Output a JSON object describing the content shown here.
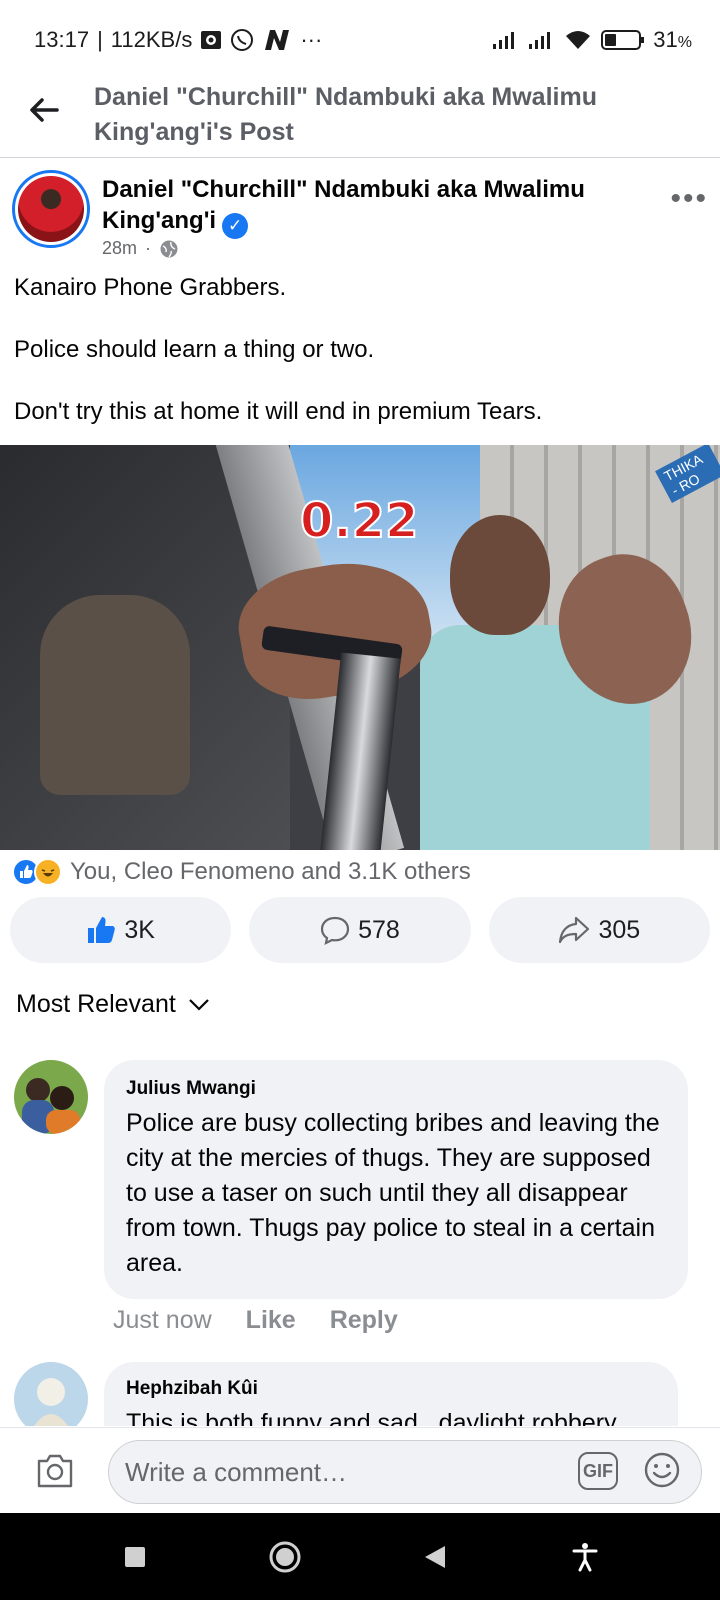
{
  "status_bar": {
    "time": "13:17",
    "speed": "112KB/s",
    "battery": "31",
    "battery_unit": "%"
  },
  "header": {
    "title": "Daniel \"Churchill\" Ndambuki aka Mwalimu King'ang'i's Post"
  },
  "post": {
    "author": "Daniel \"Churchill\" Ndambuki aka Mwalimu King'ang'i",
    "time": "28m",
    "paragraphs": [
      "Kanairo Phone Grabbers.",
      "Police should learn a thing or two.",
      "Don't try this at home it will end in premium Tears."
    ],
    "video_timer": "0.22",
    "video_sign": "THIKA - RO",
    "reactions_text": "You, Cleo Fenomeno and 3.1K others",
    "like_count": "3K",
    "comment_count": "578",
    "share_count": "305"
  },
  "sort": {
    "label": "Most Relevant"
  },
  "comments": [
    {
      "name": "Julius Mwangi",
      "text": "Police are busy collecting bribes and leaving the city at the mercies of thugs. They are supposed to use a taser on such until they all disappear from town. Thugs pay police to steal in a certain area.",
      "time": "Just now",
      "like": "Like",
      "reply": "Reply"
    },
    {
      "name": "Hephzibah Kûi",
      "text": "This is both funny and sad...daylight robbery"
    }
  ],
  "composer": {
    "placeholder": "Write a comment…",
    "gif": "GIF"
  },
  "colors": {
    "accent": "#1877f2",
    "bubble": "#f0f2f5",
    "muted": "#65676b"
  }
}
